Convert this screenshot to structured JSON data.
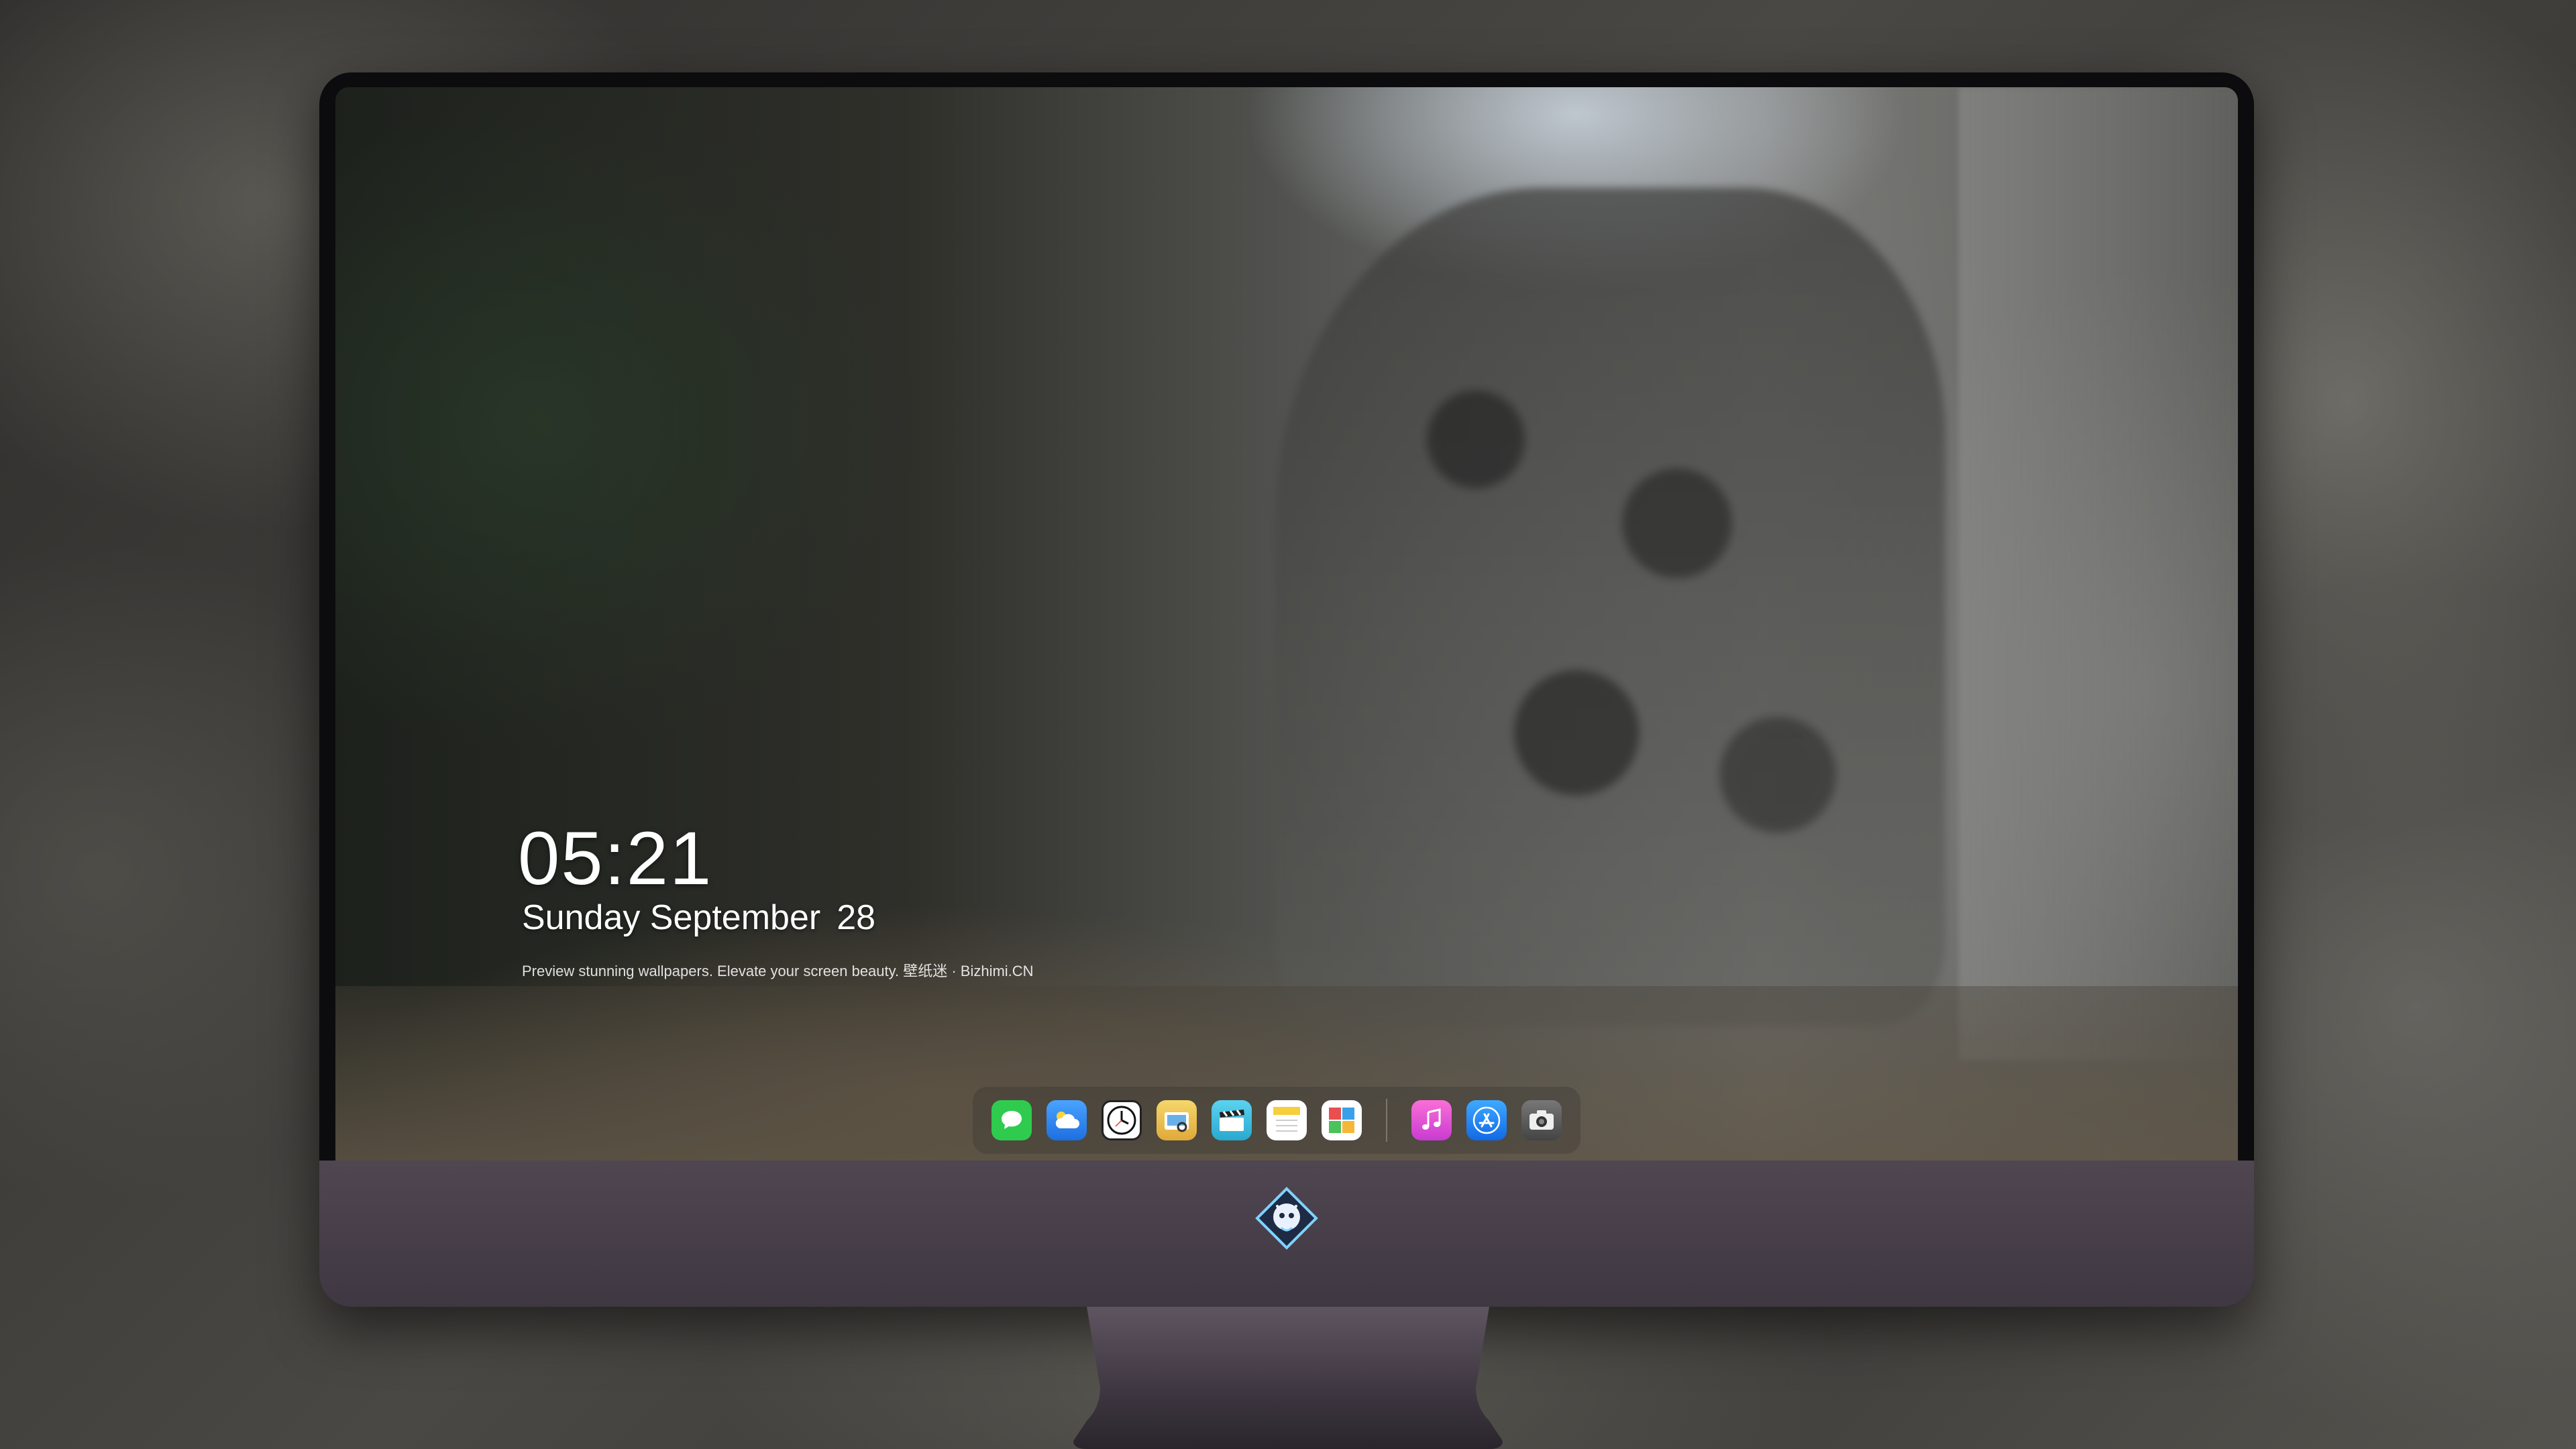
{
  "lockscreen": {
    "time": "05:21",
    "weekday_month": "Sunday September",
    "day": "28",
    "caption": "Preview stunning wallpapers. Elevate your screen beauty. 壁纸迷 · Bizhimi.CN"
  },
  "dock": {
    "apps": [
      {
        "name": "messages",
        "icon": "chat-bubble-icon",
        "color": "#2fcb4e"
      },
      {
        "name": "weather",
        "icon": "cloud-icon",
        "color": "#3e8ff2"
      },
      {
        "name": "clock",
        "icon": "clock-icon",
        "color": "#ffffff"
      },
      {
        "name": "preview",
        "icon": "photo-viewer-icon",
        "color": "#e8c24a"
      },
      {
        "name": "claquette",
        "icon": "clapperboard-icon",
        "color": "#3fc2e0"
      },
      {
        "name": "notes",
        "icon": "notepad-icon",
        "color": "#f7d64b"
      },
      {
        "name": "photo-booth",
        "icon": "photo-grid-icon",
        "color": "#e94f4f"
      },
      {
        "name": "music",
        "icon": "music-note-icon",
        "color": "#f052c8"
      },
      {
        "name": "app-store",
        "icon": "app-store-icon",
        "color": "#1b7cf2"
      },
      {
        "name": "camera",
        "icon": "camera-icon",
        "color": "#555555"
      }
    ]
  },
  "colors": {
    "chin": "#4a414c",
    "bezel": "#0c0c0e"
  }
}
